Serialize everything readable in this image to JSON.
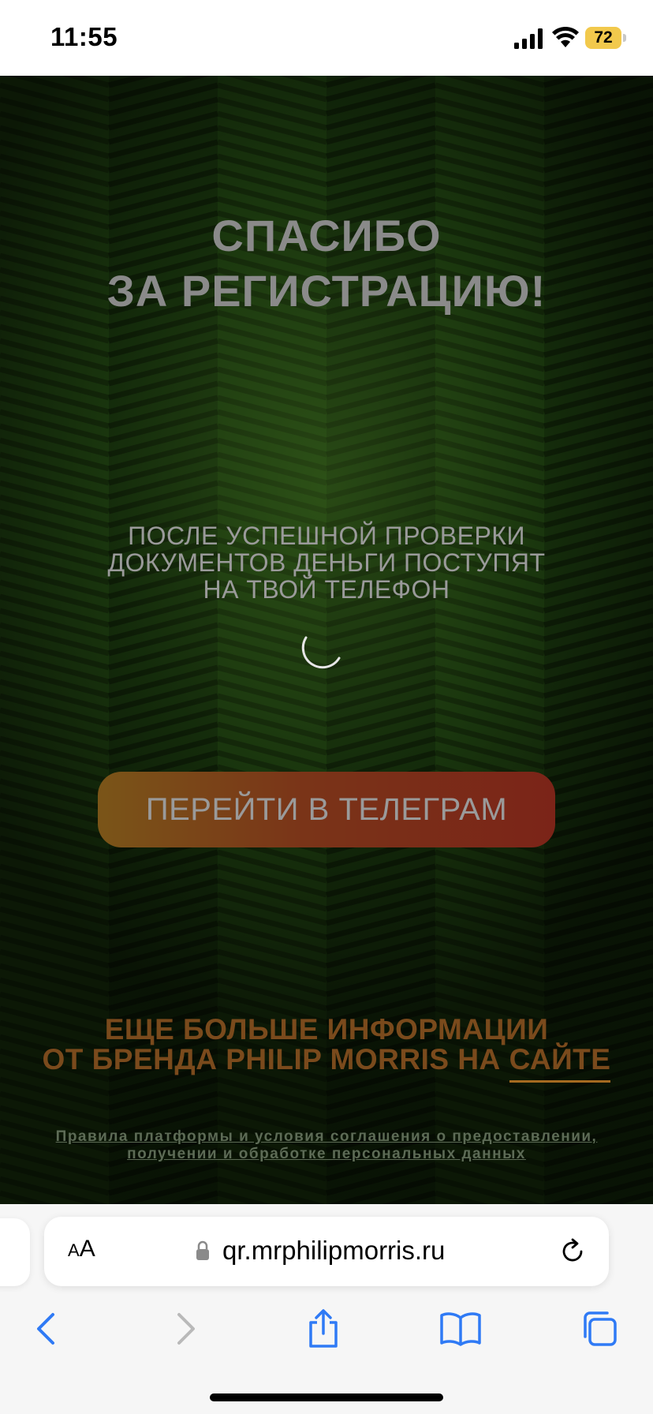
{
  "status_bar": {
    "time": "11:55",
    "battery_level": "72",
    "battery_color": "#f2c94c"
  },
  "page": {
    "title_lines": [
      "СПАСИБО",
      "ЗА РЕГИСТРАЦИЮ!"
    ],
    "info_lines": [
      "ПОСЛЕ УСПЕШНОЙ ПРОВЕРКИ",
      "ДОКУМЕНТОВ ДЕНЬГИ ПОСТУПЯТ",
      "НА ТВОЙ ТЕЛЕФОН"
    ],
    "telegram_button_label": "ПЕРЕЙТИ В ТЕЛЕГРАМ",
    "more_info_line1": "ЕЩЕ БОЛЬШЕ ИНФОРМАЦИИ",
    "more_info_line2_prefix": "ОТ БРЕНДА PHILIP MORRIS НА ",
    "more_info_link": "САЙТЕ",
    "rules_lines": [
      "Правила платформы и условия соглашения о предоставлении,",
      "получении и обработке персональных данных"
    ],
    "background_color": "#17300d",
    "accent_color": "#7a4a1c"
  },
  "browser": {
    "aa_label_small": "A",
    "aa_label_large": "A",
    "url": "qr.mrphilipmorris.ru",
    "icons": {
      "lock": "lock-icon",
      "reload": "reload-icon",
      "back": "chevron-left-icon",
      "forward": "chevron-right-icon",
      "share": "share-icon",
      "bookmarks": "book-icon",
      "tabs": "tabs-icon"
    }
  }
}
